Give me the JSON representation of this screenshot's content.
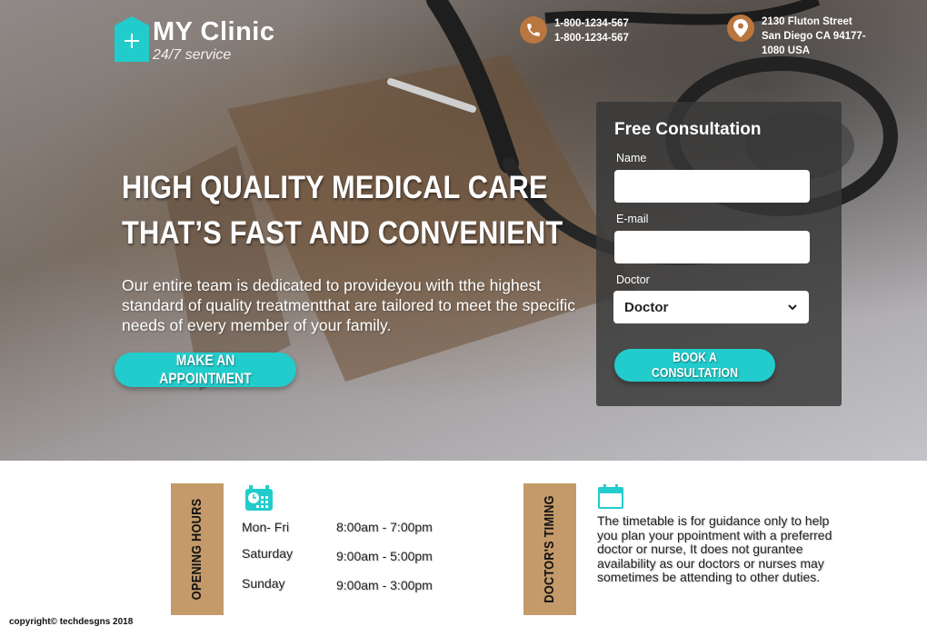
{
  "header": {
    "logo_title": "MY Clinic",
    "logo_subtitle": "24/7 service",
    "phone_line1": "1-800-1234-567",
    "phone_line2": "1-800-1234-567",
    "address_line1": "2130 Fluton Street",
    "address_line2": "San Diego CA 94177-",
    "address_line3": "1080 USA"
  },
  "hero": {
    "headline_line1": "HIGH QUALITY MEDICAL CARE",
    "headline_line2": "THAT’S FAST AND CONVENIENT",
    "description": "Our entire team is dedicated to provideyou with tthe highest standard of quality treatmentthat are tailored to meet the specific needs of every member of your family.",
    "appointment_button": "MAKE AN APPOINTMENT"
  },
  "form": {
    "title": "Free Consultation",
    "name_label": "Name",
    "name_value": "",
    "email_label": "E-mail",
    "email_value": "",
    "doctor_label": "Doctor",
    "doctor_selected": "Doctor",
    "submit_button": "BOOK A CONSULTATION"
  },
  "opening_hours": {
    "tab_label": "OPENING HOURS",
    "rows": [
      {
        "day": "Mon- Fri",
        "time": "8:00am - 7:00pm"
      },
      {
        "day": "Saturday",
        "time": "9:00am - 5:00pm"
      },
      {
        "day": "Sunday",
        "time": "9:00am - 3:00pm"
      }
    ]
  },
  "doctors_timing": {
    "tab_label": "DOCTOR'S TIMING",
    "text": "The timetable is for guidance only to help you plan your ppointment with a preferred doctor  or nurse, It does not gurantee availability as our doctors or nurses may sometimes be attending  to other duties."
  },
  "footer": {
    "copyright": "copyright© techdesgns 2018"
  },
  "colors": {
    "accent_cyan": "#22cccc",
    "brand_brown": "#c49a6a",
    "icon_brown": "#b9763e"
  }
}
